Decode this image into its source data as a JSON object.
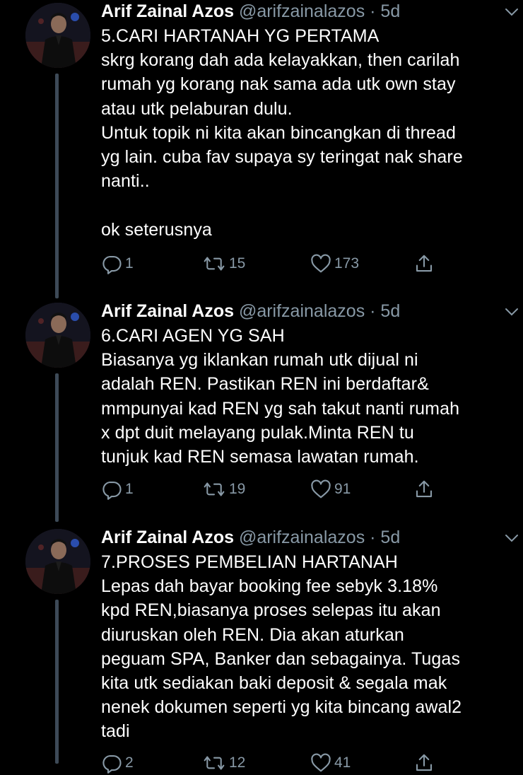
{
  "tweets": [
    {
      "author_name": "Arif Zainal Azos",
      "handle": "@arifzainalazos",
      "time": " · 5d",
      "lines": [
        "5.CARI HARTANAH YG PERTAMA",
        "skrg korang dah ada kelayakkan, then carilah",
        "rumah yg korang nak sama ada utk own stay",
        "atau utk pelaburan dulu.",
        "Untuk topik ni kita akan bincangkan di thread",
        "yg lain. cuba fav supaya sy teringat nak share",
        "nanti..",
        "",
        "ok seterusnya"
      ],
      "replies": "1",
      "retweets": "15",
      "likes": "173"
    },
    {
      "author_name": "Arif Zainal Azos",
      "handle": "@arifzainalazos",
      "time": " · 5d",
      "lines": [
        "6.CARI AGEN YG SAH",
        "Biasanya yg iklankan rumah utk dijual ni",
        "adalah REN. Pastikan REN ini berdaftar&",
        "mmpunyai kad REN yg sah takut nanti rumah",
        "x dpt duit melayang pulak.Minta REN tu",
        "tunjuk kad REN semasa lawatan rumah."
      ],
      "replies": "1",
      "retweets": "19",
      "likes": "91"
    },
    {
      "author_name": "Arif Zainal Azos",
      "handle": "@arifzainalazos",
      "time": " · 5d",
      "lines": [
        "7.PROSES PEMBELIAN HARTANAH",
        "Lepas dah bayar booking fee sebyk 3.18%",
        "kpd REN,biasanya proses selepas itu akan",
        "diuruskan oleh REN. Dia akan aturkan",
        "peguam SPA, Banker dan sebagainya. Tugas",
        "kita utk sediakan baki deposit & segala mak",
        "nenek dokumen seperti yg kita bincang awal2",
        "tadi"
      ],
      "replies": "2",
      "retweets": "12",
      "likes": "41"
    }
  ],
  "colors": {
    "background": "#000000",
    "text": "#ffffff",
    "secondary": "#8899a6",
    "thread_line": "#3d4a57"
  },
  "icons": [
    "reply-icon",
    "retweet-icon",
    "like-icon",
    "share-icon",
    "chevron-down-icon"
  ]
}
